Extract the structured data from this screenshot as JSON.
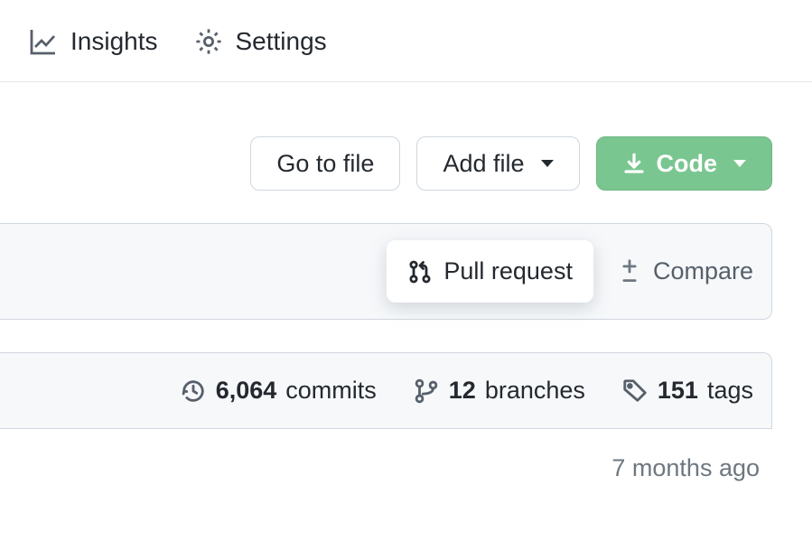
{
  "nav": {
    "insights": "Insights",
    "settings": "Settings"
  },
  "actions": {
    "go_to_file": "Go to file",
    "add_file": "Add file",
    "code": "Code"
  },
  "branch_bar": {
    "pull_request": "Pull request",
    "compare": "Compare"
  },
  "stats": {
    "commits_count": "6,064",
    "commits_label": "commits",
    "branches_count": "12",
    "branches_label": "branches",
    "tags_count": "151",
    "tags_label": "tags"
  },
  "file_row": {
    "timestamp": "7 months ago"
  }
}
